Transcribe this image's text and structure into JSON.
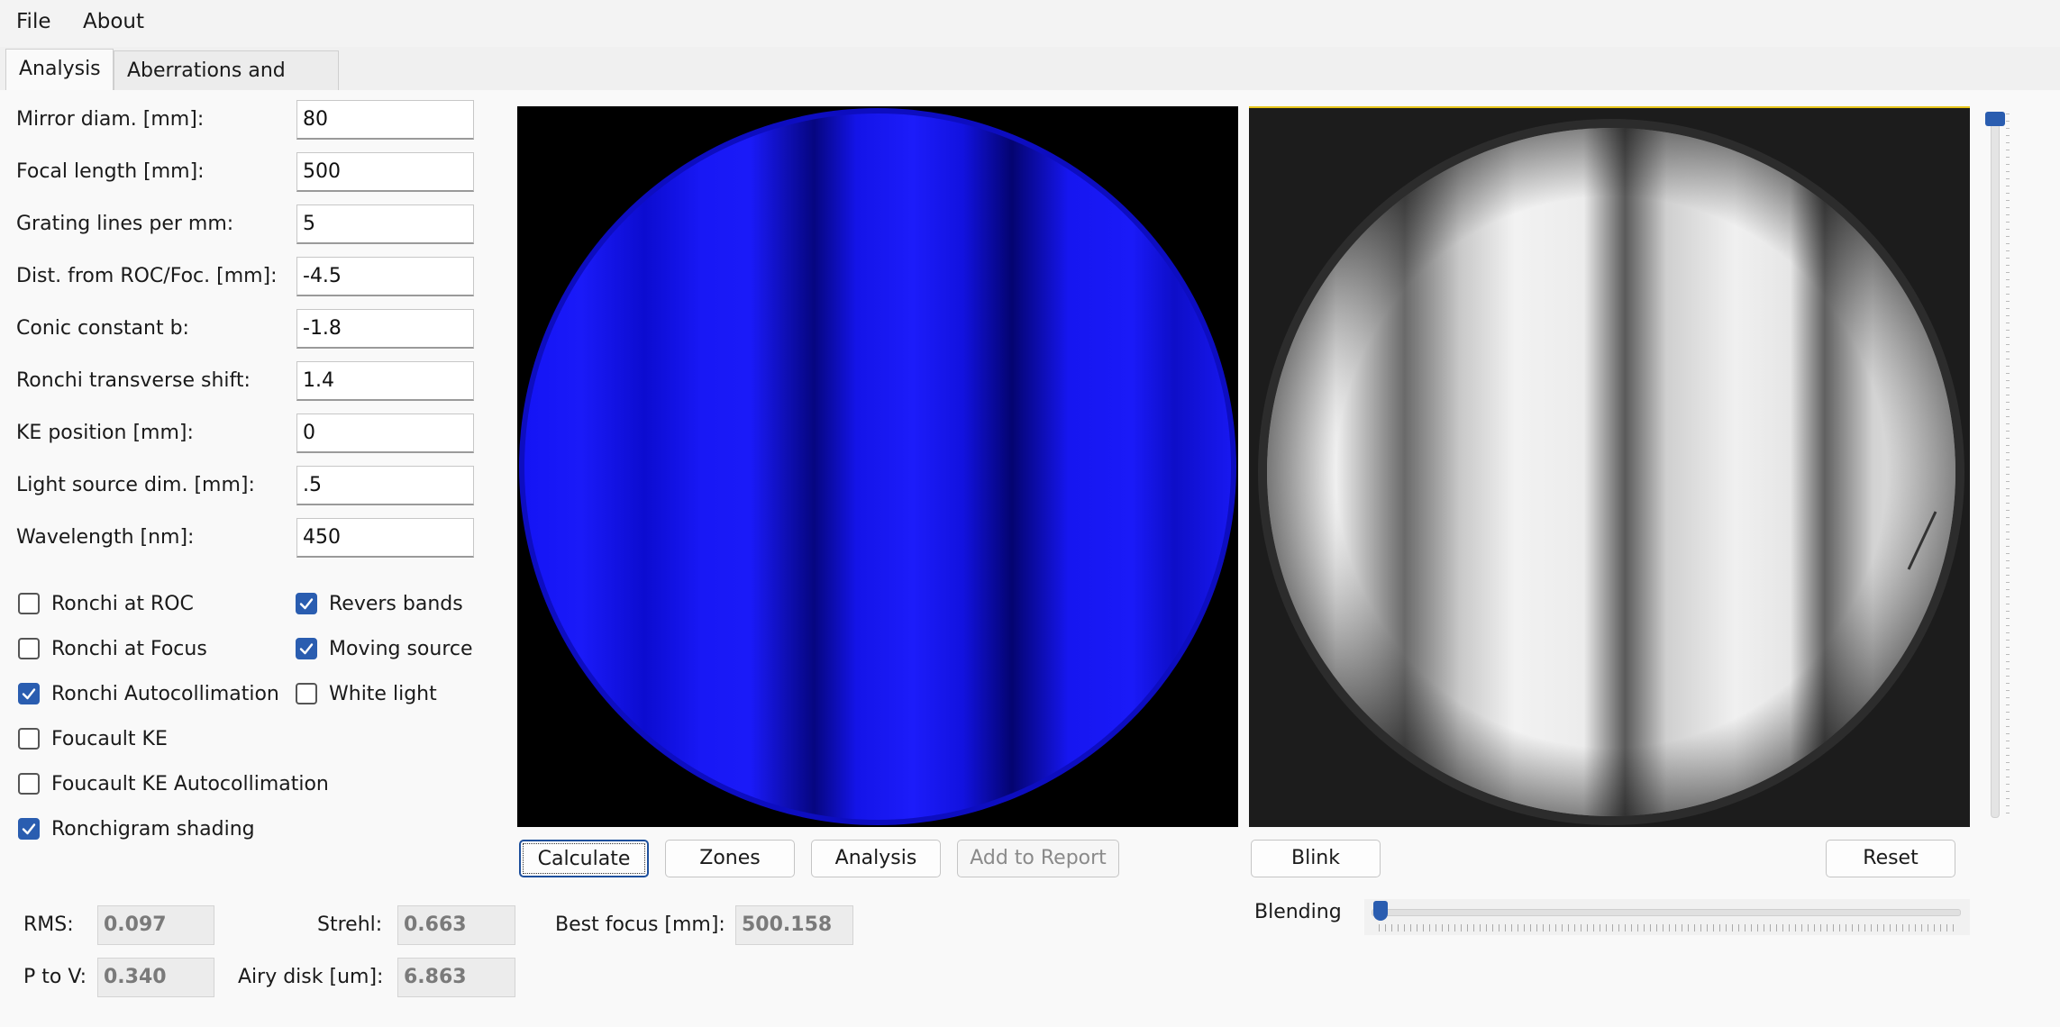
{
  "menu": {
    "file": "File",
    "about": "About"
  },
  "tabs": [
    {
      "label": "Analysis",
      "active": true
    },
    {
      "label": "Aberrations and Zones",
      "active": false
    }
  ],
  "params": [
    {
      "label": "Mirror diam. [mm]:",
      "value": "80"
    },
    {
      "label": "Focal length [mm]:",
      "value": "500"
    },
    {
      "label": "Grating lines per mm:",
      "value": "5"
    },
    {
      "label": "Dist. from ROC/Foc. [mm]:",
      "value": "-4.5"
    },
    {
      "label": "Conic constant b:",
      "value": "-1.8"
    },
    {
      "label": "Ronchi transverse shift:",
      "value": "1.4"
    },
    {
      "label": "KE position [mm]:",
      "value": "0"
    },
    {
      "label": "Light source dim. [mm]:",
      "value": ".5"
    },
    {
      "label": "Wavelength [nm]:",
      "value": "450"
    }
  ],
  "options": {
    "ronchi_roc": {
      "label": "Ronchi at ROC",
      "checked": false
    },
    "ronchi_focus": {
      "label": "Ronchi at Focus",
      "checked": false
    },
    "ronchi_autocoll": {
      "label": "Ronchi Autocollimation",
      "checked": true
    },
    "foucault_ke": {
      "label": "Foucault KE",
      "checked": false
    },
    "foucault_ke_autocoll": {
      "label": "Foucault KE Autocollimation",
      "checked": false
    },
    "ronchigram_shading": {
      "label": "Ronchigram shading",
      "checked": true
    },
    "revers_bands": {
      "label": "Revers bands",
      "checked": true
    },
    "moving_source": {
      "label": "Moving source",
      "checked": true
    },
    "white_light": {
      "label": "White light",
      "checked": false
    }
  },
  "buttons": {
    "calculate": "Calculate",
    "zones": "Zones",
    "analysis": "Analysis",
    "add_to_report": "Add to Report",
    "blink": "Blink",
    "reset": "Reset"
  },
  "results": {
    "rms_label": "RMS:",
    "rms": "0.097",
    "p_to_v_label": "P to V:",
    "p_to_v": "0.340",
    "strehl_label": "Strehl:",
    "strehl": "0.663",
    "airy_label": "Airy disk [um]:",
    "airy": "6.863",
    "best_focus_label": "Best focus [mm]:",
    "best_focus": "500.158"
  },
  "blending": {
    "label": "Blending",
    "level": 0.0
  },
  "vertical_slider": {
    "level": 1.0
  },
  "colors": {
    "accent": "#2a5db0",
    "ronchigram": "#1010f0",
    "photo_border": "#e6c417"
  }
}
